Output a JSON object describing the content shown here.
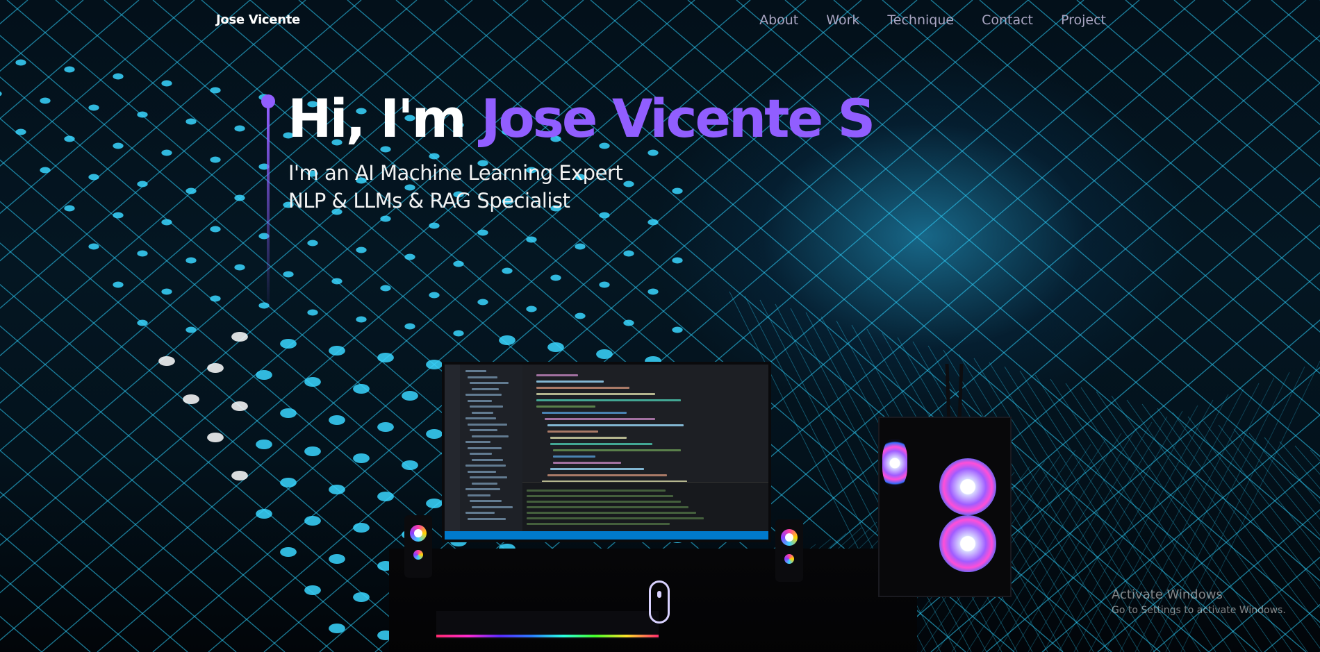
{
  "nav": {
    "brand": "Jose Vicente",
    "links": [
      "About",
      "Work",
      "Technique",
      "Contact",
      "Project"
    ]
  },
  "hero": {
    "greeting": "Hi, I'm ",
    "name": "Jose Vicente S",
    "subtitle_line1": "I'm an AI Machine Learning Expert",
    "subtitle_line2": "NLP & LLMs & RAG Specialist"
  },
  "windows_watermark": {
    "title": "Activate Windows",
    "subtitle": "Go to Settings to activate Windows."
  },
  "colors": {
    "accent": "#915eff",
    "nav_link": "#aaa6c3",
    "background": "#050816",
    "grid_glow": "#2fd3ff"
  }
}
